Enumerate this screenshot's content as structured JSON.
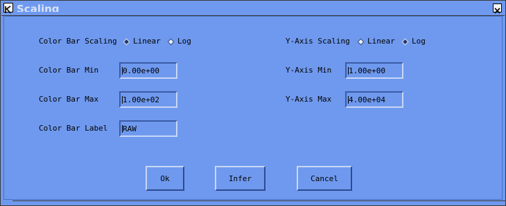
{
  "window": {
    "title": "Scaling",
    "app_icon": "k-icon",
    "close_icon": "close-x-icon",
    "close_glyph": "✕",
    "k_glyph": "K"
  },
  "color_bar": {
    "scaling_label": "Color Bar Scaling",
    "scaling_options": [
      {
        "label": "Linear",
        "selected": true
      },
      {
        "label": "Log",
        "selected": false
      }
    ],
    "min_label": "Color Bar Min",
    "min_value": "0.00e+00",
    "max_label": "Color Bar Max",
    "max_value": "1.00e+02",
    "label_label": "Color Bar Label",
    "label_value": "RAW"
  },
  "y_axis": {
    "scaling_label": "Y-Axis Scaling",
    "scaling_options": [
      {
        "label": "Linear",
        "selected": false
      },
      {
        "label": "Log",
        "selected": true
      }
    ],
    "min_label": "Y-Axis Min",
    "min_value": "1.00e+00",
    "max_label": "Y-Axis Max",
    "max_value": "4.00e+04"
  },
  "buttons": {
    "ok": "Ok",
    "infer": "Infer",
    "cancel": "Cancel"
  },
  "colors": {
    "background": "#6f99ee",
    "selected_radio": "#24386e"
  }
}
